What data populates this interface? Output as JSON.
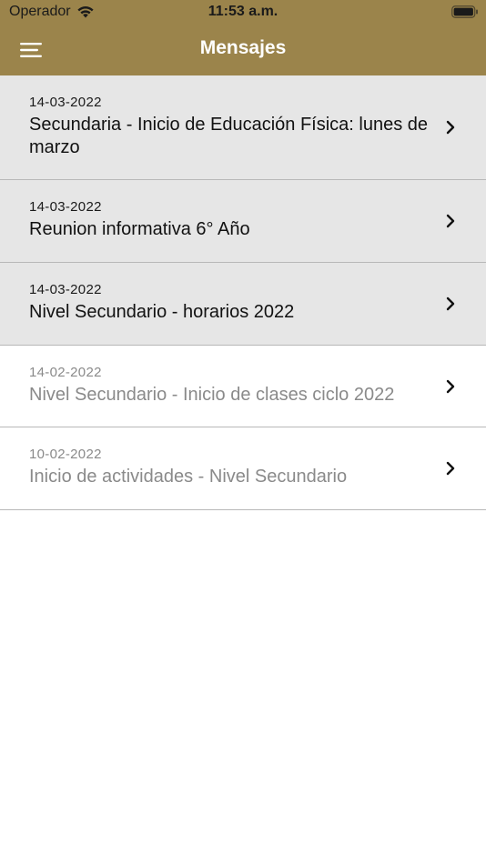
{
  "status_bar": {
    "carrier": "Operador",
    "time": "11:53 a.m."
  },
  "nav": {
    "title": "Mensajes",
    "menu_icon": "hamburger-menu-icon"
  },
  "colors": {
    "header": "#9b844b",
    "unread_row": "#e6e6e6",
    "read_text": "#8a8a8a"
  },
  "messages": [
    {
      "date": "14-03-2022",
      "title": "Secundaria - Inicio de Educación Física: lunes de marzo",
      "read": false
    },
    {
      "date": "14-03-2022",
      "title": "Reunion informativa 6° Año",
      "read": false
    },
    {
      "date": "14-03-2022",
      "title": "Nivel Secundario - horarios 2022",
      "read": false
    },
    {
      "date": "14-02-2022",
      "title": "Nivel Secundario - Inicio de clases ciclo 2022",
      "read": true
    },
    {
      "date": "10-02-2022",
      "title": "Inicio de actividades - Nivel Secundario",
      "read": true
    }
  ]
}
